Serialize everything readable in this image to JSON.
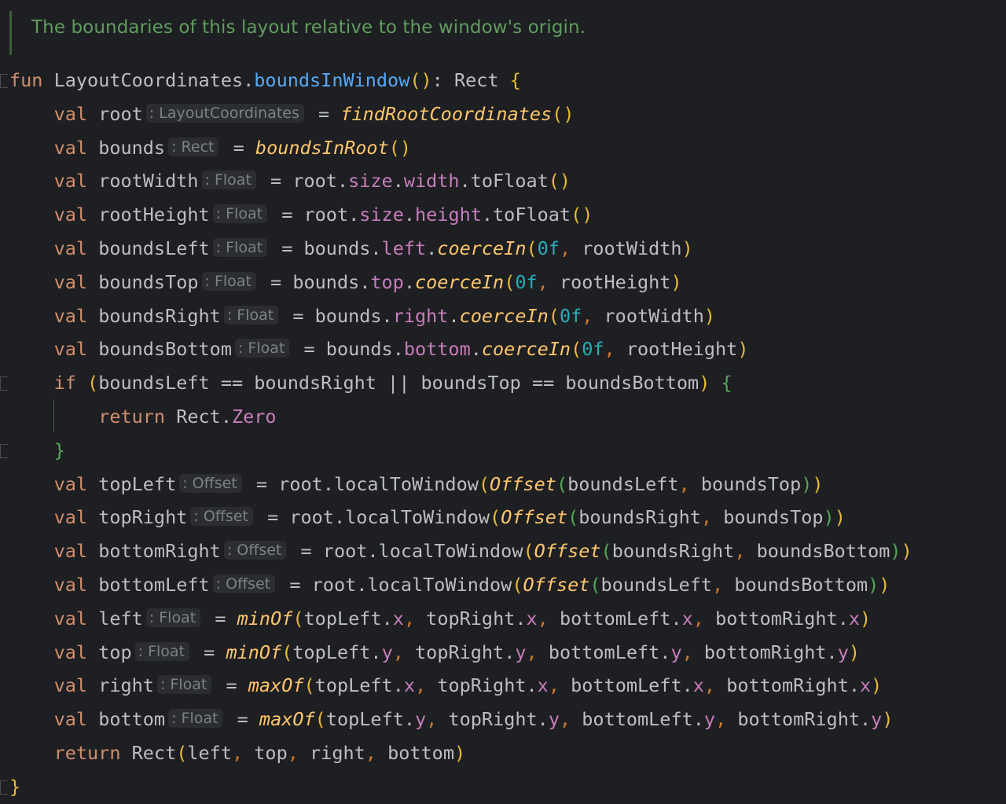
{
  "doc_comment": "The boundaries of this layout relative to the window's origin.",
  "colors": {
    "background": "#1e1f22",
    "keyword": "#cf8e6d",
    "identifier": "#bcbec4",
    "function_decl": "#56a8f5",
    "function_call_italic": "#ffc66d",
    "property": "#c77dbb",
    "number": "#2aacb8",
    "comma": "#cc7832",
    "bracket_level1": "#e8ba36",
    "bracket_level2": "#54a857",
    "bracket_level3": "#359ff4",
    "inlay_hint_bg": "#2b2d30",
    "inlay_hint_text": "#7d8089",
    "doc_comment": "#5f9d5f"
  },
  "lines": [
    [
      [
        "kw",
        "fun"
      ],
      [
        "id",
        " LayoutCoordinates."
      ],
      [
        "fn",
        "boundsInWindow"
      ],
      [
        "b1",
        "()"
      ],
      [
        "pun",
        ": Rect "
      ],
      [
        "b1",
        "{"
      ]
    ],
    [
      [
        "id",
        "    "
      ],
      [
        "kw",
        "val"
      ],
      [
        "id",
        " root"
      ],
      [
        "hint",
        ": LayoutCoordinates"
      ],
      [
        "op",
        " = "
      ],
      [
        "fi",
        "findRootCoordinates"
      ],
      [
        "b1",
        "()"
      ]
    ],
    [
      [
        "id",
        "    "
      ],
      [
        "kw",
        "val"
      ],
      [
        "id",
        " bounds"
      ],
      [
        "hint",
        ": Rect"
      ],
      [
        "op",
        " = "
      ],
      [
        "fi",
        "boundsInRoot"
      ],
      [
        "b1",
        "()"
      ]
    ],
    [
      [
        "id",
        "    "
      ],
      [
        "kw",
        "val"
      ],
      [
        "id",
        " rootWidth"
      ],
      [
        "hint",
        ": Float"
      ],
      [
        "op",
        " = root."
      ],
      [
        "prop",
        "size"
      ],
      [
        "pun",
        "."
      ],
      [
        "prop",
        "width"
      ],
      [
        "pun",
        ".toFloat"
      ],
      [
        "b1",
        "()"
      ]
    ],
    [
      [
        "id",
        "    "
      ],
      [
        "kw",
        "val"
      ],
      [
        "id",
        " rootHeight"
      ],
      [
        "hint",
        ": Float"
      ],
      [
        "op",
        " = root."
      ],
      [
        "prop",
        "size"
      ],
      [
        "pun",
        "."
      ],
      [
        "prop",
        "height"
      ],
      [
        "pun",
        ".toFloat"
      ],
      [
        "b1",
        "()"
      ]
    ],
    [
      [
        "id",
        "    "
      ],
      [
        "kw",
        "val"
      ],
      [
        "id",
        " boundsLeft"
      ],
      [
        "hint",
        ": Float"
      ],
      [
        "op",
        " = bounds."
      ],
      [
        "prop",
        "left"
      ],
      [
        "pun",
        "."
      ],
      [
        "fi",
        "coerceIn"
      ],
      [
        "b1",
        "("
      ],
      [
        "num",
        "0f"
      ],
      [
        "cm",
        ","
      ],
      [
        "id",
        " rootWidth"
      ],
      [
        "b1",
        ")"
      ]
    ],
    [
      [
        "id",
        "    "
      ],
      [
        "kw",
        "val"
      ],
      [
        "id",
        " boundsTop"
      ],
      [
        "hint",
        ": Float"
      ],
      [
        "op",
        " = bounds."
      ],
      [
        "prop",
        "top"
      ],
      [
        "pun",
        "."
      ],
      [
        "fi",
        "coerceIn"
      ],
      [
        "b1",
        "("
      ],
      [
        "num",
        "0f"
      ],
      [
        "cm",
        ","
      ],
      [
        "id",
        " rootHeight"
      ],
      [
        "b1",
        ")"
      ]
    ],
    [
      [
        "id",
        "    "
      ],
      [
        "kw",
        "val"
      ],
      [
        "id",
        " boundsRight"
      ],
      [
        "hint",
        ": Float"
      ],
      [
        "op",
        " = bounds."
      ],
      [
        "prop",
        "right"
      ],
      [
        "pun",
        "."
      ],
      [
        "fi",
        "coerceIn"
      ],
      [
        "b1",
        "("
      ],
      [
        "num",
        "0f"
      ],
      [
        "cm",
        ","
      ],
      [
        "id",
        " rootWidth"
      ],
      [
        "b1",
        ")"
      ]
    ],
    [
      [
        "id",
        "    "
      ],
      [
        "kw",
        "val"
      ],
      [
        "id",
        " boundsBottom"
      ],
      [
        "hint",
        ": Float"
      ],
      [
        "op",
        " = bounds."
      ],
      [
        "prop",
        "bottom"
      ],
      [
        "pun",
        "."
      ],
      [
        "fi",
        "coerceIn"
      ],
      [
        "b1",
        "("
      ],
      [
        "num",
        "0f"
      ],
      [
        "cm",
        ","
      ],
      [
        "id",
        " rootHeight"
      ],
      [
        "b1",
        ")"
      ]
    ],
    [
      [
        "id",
        "    "
      ],
      [
        "kw",
        "if"
      ],
      [
        "id",
        " "
      ],
      [
        "b1",
        "("
      ],
      [
        "id",
        "boundsLeft == boundsRight || boundsTop == boundsBottom"
      ],
      [
        "b1",
        ")"
      ],
      [
        "id",
        " "
      ],
      [
        "b2",
        "{"
      ]
    ],
    [
      [
        "id",
        "        "
      ],
      [
        "kw",
        "return"
      ],
      [
        "id",
        " Rect."
      ],
      [
        "prop",
        "Zero"
      ]
    ],
    [
      [
        "id",
        "    "
      ],
      [
        "b2",
        "}"
      ]
    ],
    [
      [
        "id",
        "    "
      ],
      [
        "kw",
        "val"
      ],
      [
        "id",
        " topLeft"
      ],
      [
        "hint",
        ": Offset"
      ],
      [
        "op",
        " = root.localToWindow"
      ],
      [
        "b1",
        "("
      ],
      [
        "fi",
        "Offset"
      ],
      [
        "b2",
        "("
      ],
      [
        "id",
        "boundsLeft"
      ],
      [
        "cm",
        ","
      ],
      [
        "id",
        " boundsTop"
      ],
      [
        "b2",
        ")"
      ],
      [
        "b1",
        ")"
      ]
    ],
    [
      [
        "id",
        "    "
      ],
      [
        "kw",
        "val"
      ],
      [
        "id",
        " topRight"
      ],
      [
        "hint",
        ": Offset"
      ],
      [
        "op",
        " = root.localToWindow"
      ],
      [
        "b1",
        "("
      ],
      [
        "fi",
        "Offset"
      ],
      [
        "b2",
        "("
      ],
      [
        "id",
        "boundsRight"
      ],
      [
        "cm",
        ","
      ],
      [
        "id",
        " boundsTop"
      ],
      [
        "b2",
        ")"
      ],
      [
        "b1",
        ")"
      ]
    ],
    [
      [
        "id",
        "    "
      ],
      [
        "kw",
        "val"
      ],
      [
        "id",
        " bottomRight"
      ],
      [
        "hint",
        ": Offset"
      ],
      [
        "op",
        " = root.localToWindow"
      ],
      [
        "b1",
        "("
      ],
      [
        "fi",
        "Offset"
      ],
      [
        "b2",
        "("
      ],
      [
        "id",
        "boundsRight"
      ],
      [
        "cm",
        ","
      ],
      [
        "id",
        " boundsBottom"
      ],
      [
        "b2",
        ")"
      ],
      [
        "b1",
        ")"
      ]
    ],
    [
      [
        "id",
        "    "
      ],
      [
        "kw",
        "val"
      ],
      [
        "id",
        " bottomLeft"
      ],
      [
        "hint",
        ": Offset"
      ],
      [
        "op",
        " = root.localToWindow"
      ],
      [
        "b1",
        "("
      ],
      [
        "fi",
        "Offset"
      ],
      [
        "b2",
        "("
      ],
      [
        "id",
        "boundsLeft"
      ],
      [
        "cm",
        ","
      ],
      [
        "id",
        " boundsBottom"
      ],
      [
        "b2",
        ")"
      ],
      [
        "b1",
        ")"
      ]
    ],
    [
      [
        "id",
        "    "
      ],
      [
        "kw",
        "val"
      ],
      [
        "id",
        " left"
      ],
      [
        "hint",
        ": Float"
      ],
      [
        "op",
        " = "
      ],
      [
        "fi",
        "minOf"
      ],
      [
        "b1",
        "("
      ],
      [
        "id",
        "topLeft."
      ],
      [
        "prop",
        "x"
      ],
      [
        "cm",
        ","
      ],
      [
        "id",
        " topRight."
      ],
      [
        "prop",
        "x"
      ],
      [
        "cm",
        ","
      ],
      [
        "id",
        " bottomLeft."
      ],
      [
        "prop",
        "x"
      ],
      [
        "cm",
        ","
      ],
      [
        "id",
        " bottomRight."
      ],
      [
        "prop",
        "x"
      ],
      [
        "b1",
        ")"
      ]
    ],
    [
      [
        "id",
        "    "
      ],
      [
        "kw",
        "val"
      ],
      [
        "id",
        " top"
      ],
      [
        "hint",
        ": Float"
      ],
      [
        "op",
        " = "
      ],
      [
        "fi",
        "minOf"
      ],
      [
        "b1",
        "("
      ],
      [
        "id",
        "topLeft."
      ],
      [
        "prop",
        "y"
      ],
      [
        "cm",
        ","
      ],
      [
        "id",
        " topRight."
      ],
      [
        "prop",
        "y"
      ],
      [
        "cm",
        ","
      ],
      [
        "id",
        " bottomLeft."
      ],
      [
        "prop",
        "y"
      ],
      [
        "cm",
        ","
      ],
      [
        "id",
        " bottomRight."
      ],
      [
        "prop",
        "y"
      ],
      [
        "b1",
        ")"
      ]
    ],
    [
      [
        "id",
        "    "
      ],
      [
        "kw",
        "val"
      ],
      [
        "id",
        " right"
      ],
      [
        "hint",
        ": Float"
      ],
      [
        "op",
        " = "
      ],
      [
        "fi",
        "maxOf"
      ],
      [
        "b1",
        "("
      ],
      [
        "id",
        "topLeft."
      ],
      [
        "prop",
        "x"
      ],
      [
        "cm",
        ","
      ],
      [
        "id",
        " topRight."
      ],
      [
        "prop",
        "x"
      ],
      [
        "cm",
        ","
      ],
      [
        "id",
        " bottomLeft."
      ],
      [
        "prop",
        "x"
      ],
      [
        "cm",
        ","
      ],
      [
        "id",
        " bottomRight."
      ],
      [
        "prop",
        "x"
      ],
      [
        "b1",
        ")"
      ]
    ],
    [
      [
        "id",
        "    "
      ],
      [
        "kw",
        "val"
      ],
      [
        "id",
        " bottom"
      ],
      [
        "hint",
        ": Float"
      ],
      [
        "op",
        " = "
      ],
      [
        "fi",
        "maxOf"
      ],
      [
        "b1",
        "("
      ],
      [
        "id",
        "topLeft."
      ],
      [
        "prop",
        "y"
      ],
      [
        "cm",
        ","
      ],
      [
        "id",
        " topRight."
      ],
      [
        "prop",
        "y"
      ],
      [
        "cm",
        ","
      ],
      [
        "id",
        " bottomLeft."
      ],
      [
        "prop",
        "y"
      ],
      [
        "cm",
        ","
      ],
      [
        "id",
        " bottomRight."
      ],
      [
        "prop",
        "y"
      ],
      [
        "b1",
        ")"
      ]
    ],
    [
      [
        "id",
        "    "
      ],
      [
        "kw",
        "return"
      ],
      [
        "id",
        " Rect"
      ],
      [
        "b1",
        "("
      ],
      [
        "id",
        "left"
      ],
      [
        "cm",
        ","
      ],
      [
        "id",
        " top"
      ],
      [
        "cm",
        ","
      ],
      [
        "id",
        " right"
      ],
      [
        "cm",
        ","
      ],
      [
        "id",
        " bottom"
      ],
      [
        "b1",
        ")"
      ]
    ],
    [
      [
        "b1",
        "}"
      ]
    ]
  ]
}
